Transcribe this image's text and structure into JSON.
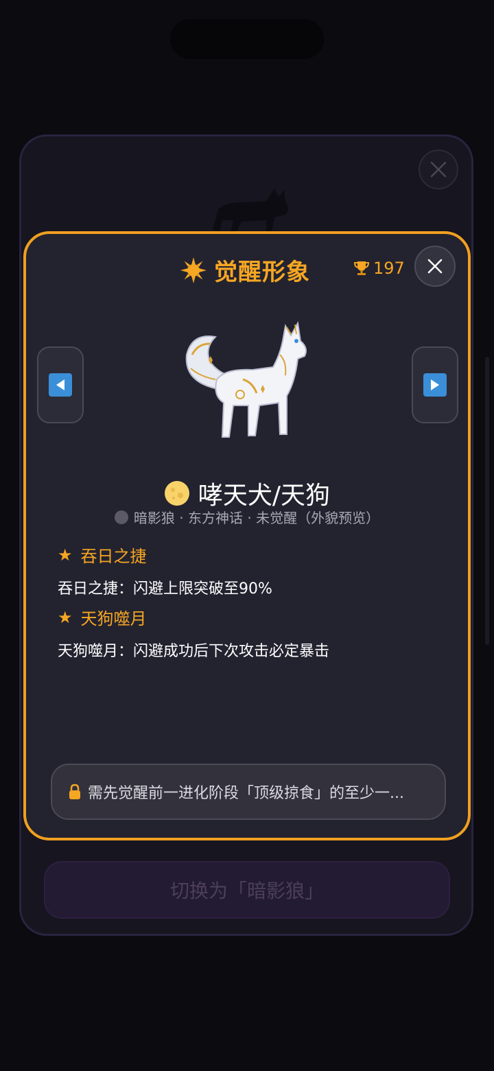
{
  "background": {
    "switch_button_label": "切换为「暗影狼」"
  },
  "modal": {
    "title": "觉醒形象",
    "trophy_count": "197",
    "character": {
      "name": "哮天犬/天狗",
      "meta": "暗影狼 · 东方神话 · 未觉醒（外貌预览）"
    },
    "skills": [
      {
        "title": "吞日之捷",
        "desc": "吞日之捷：闪避上限突破至90%"
      },
      {
        "title": "天狗噬月",
        "desc": "天狗噬月：闪避成功后下次攻击必定暴击"
      }
    ],
    "lock_message": "需先觉醒前一进化阶段「顶级掠食」的至少一..."
  },
  "icons": {
    "title_icon": "sun-icon",
    "trophy": "trophy-icon",
    "close": "close-icon",
    "prev": "arrow-left-icon",
    "next": "arrow-right-icon",
    "name_icon": "moon-icon",
    "lock": "lock-icon",
    "skill_marker": "star-icon"
  },
  "colors": {
    "accent": "#f5a623",
    "modal_border": "#f0a020",
    "modal_bg": "#23222f",
    "arrow_blue": "#3a8fd8"
  }
}
